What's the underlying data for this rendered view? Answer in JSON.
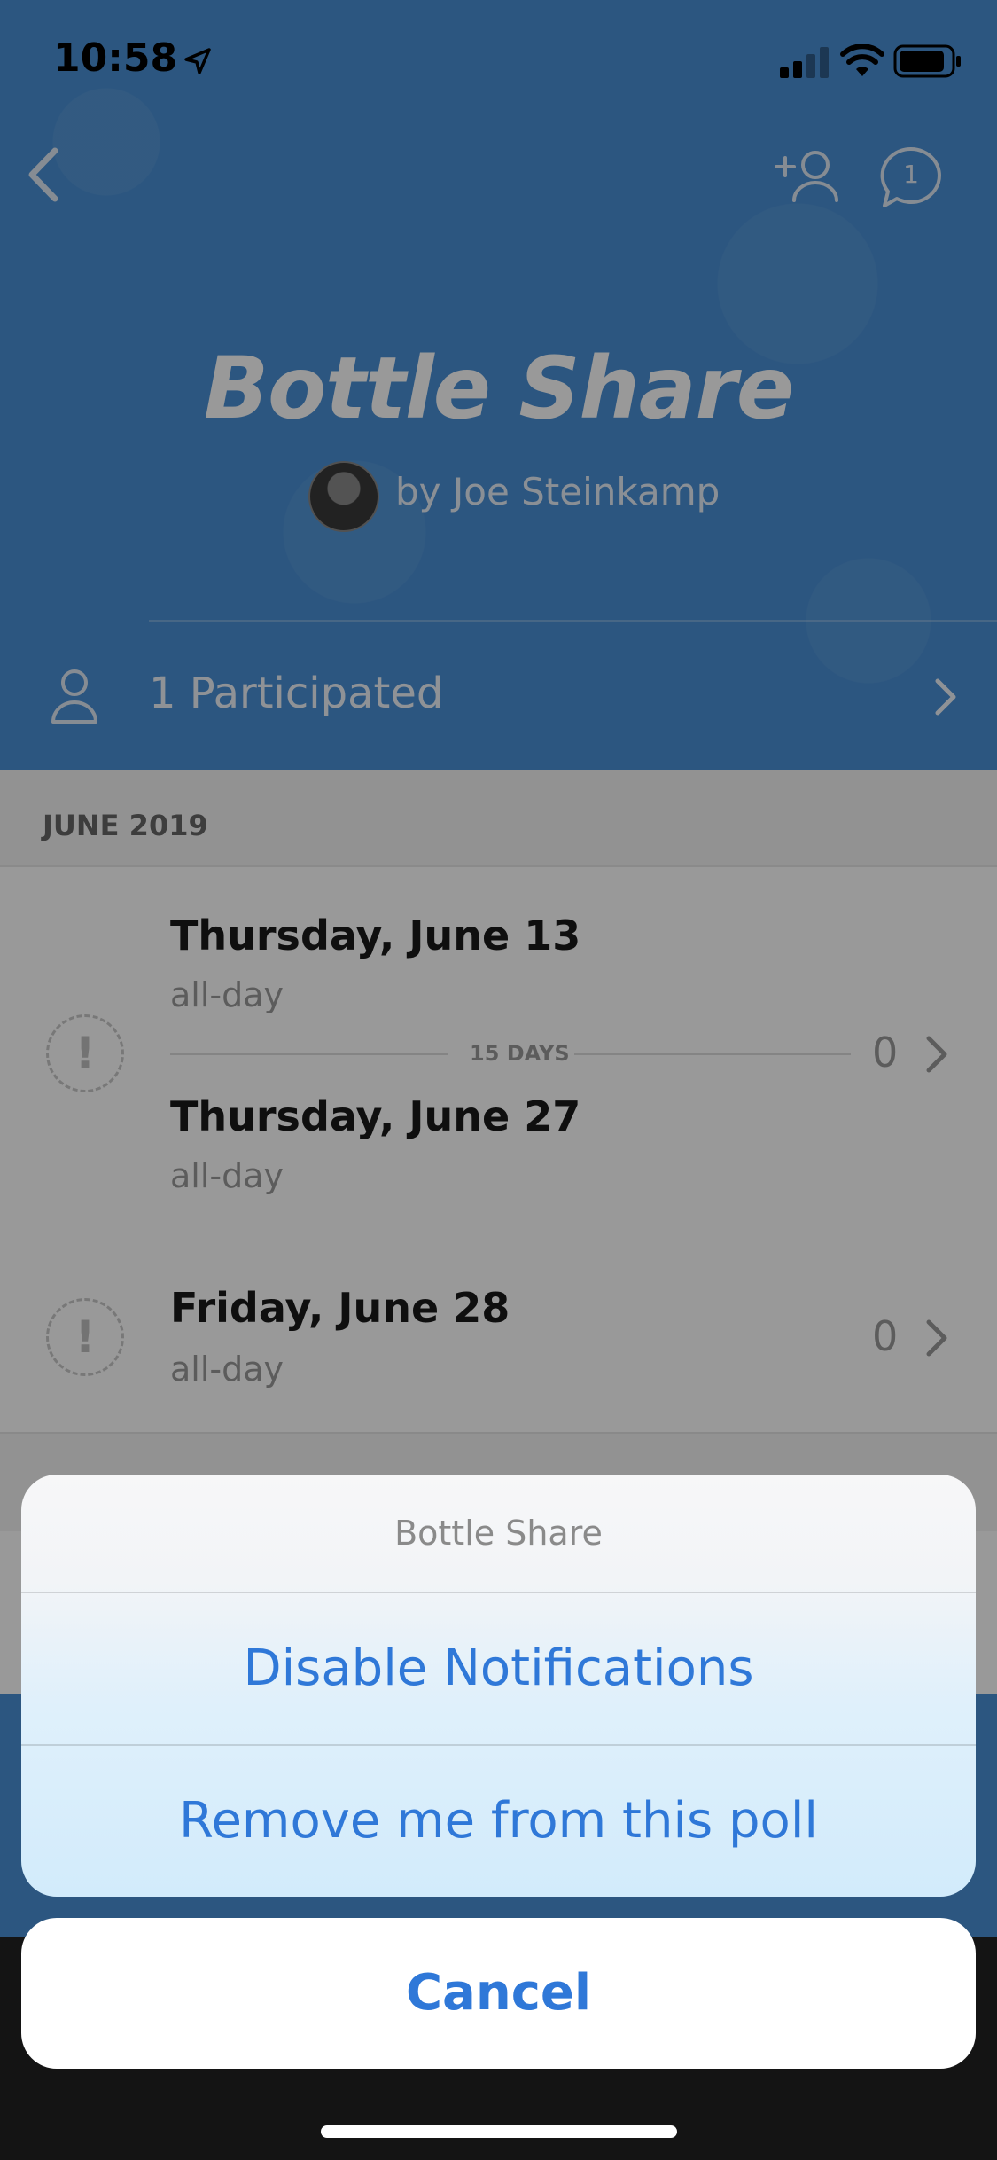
{
  "status_bar": {
    "time": "10:58"
  },
  "header": {
    "title": "Bottle Share",
    "author": "by Joe Steinkamp",
    "comment_count": "1",
    "participants_label": "1 Participated"
  },
  "list": {
    "section_title": "JUNE 2019",
    "items": [
      {
        "start_date": "Thursday, June 13",
        "start_time": "all-day",
        "span_label": "15 DAYS",
        "end_date": "Thursday, June 27",
        "end_time": "all-day",
        "count": "0"
      },
      {
        "date": "Friday, June 28",
        "time": "all-day",
        "count": "0"
      }
    ],
    "status_icon_glyph": "!"
  },
  "action_sheet": {
    "title": "Bottle Share",
    "actions": [
      "Disable Notifications",
      "Remove me from this poll"
    ],
    "cancel": "Cancel"
  },
  "colors": {
    "brand_blue": "#4a90d6",
    "action_blue": "#2f78d8"
  }
}
